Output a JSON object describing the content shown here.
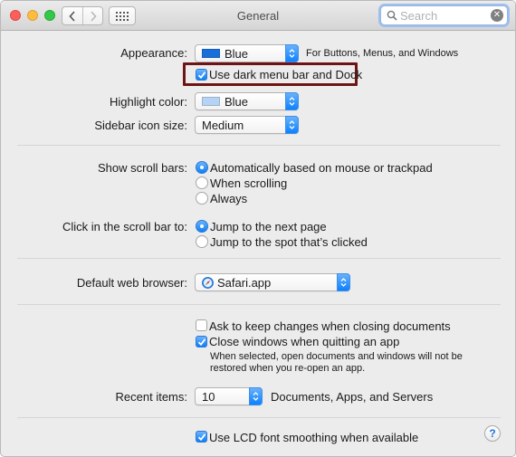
{
  "window": {
    "title": "General"
  },
  "search": {
    "placeholder": "Search"
  },
  "appearance": {
    "label": "Appearance:",
    "value": "Blue",
    "swatch_color": "#1b6fd9",
    "note": "For Buttons, Menus, and Windows",
    "dark_menu_label": "Use dark menu bar and Dock",
    "dark_menu_checked": true
  },
  "highlight": {
    "label": "Highlight color:",
    "value": "Blue",
    "swatch_color": "#b5d3f3"
  },
  "sidebar_icon": {
    "label": "Sidebar icon size:",
    "value": "Medium"
  },
  "scroll_bars": {
    "label": "Show scroll bars:",
    "options": [
      "Automatically based on mouse or trackpad",
      "When scrolling",
      "Always"
    ],
    "selected": 0
  },
  "click_scroll": {
    "label": "Click in the scroll bar to:",
    "options": [
      "Jump to the next page",
      "Jump to the spot that’s clicked"
    ],
    "selected": 0
  },
  "browser": {
    "label": "Default web browser:",
    "value": "Safari.app"
  },
  "documents": {
    "ask_keep_label": "Ask to keep changes when closing documents",
    "ask_keep_checked": false,
    "close_windows_label": "Close windows when quitting an app",
    "close_windows_checked": true,
    "close_windows_note_1": "When selected, open documents and windows will not be",
    "close_windows_note_2": "restored when you re-open an app."
  },
  "recent": {
    "label": "Recent items:",
    "value": "10",
    "note": "Documents, Apps, and Servers"
  },
  "lcd": {
    "label": "Use LCD font smoothing when available",
    "checked": true
  },
  "help": {
    "label": "?"
  },
  "colors": {
    "accent": "#0f7ff7",
    "annotation_box": "#6e1414"
  }
}
